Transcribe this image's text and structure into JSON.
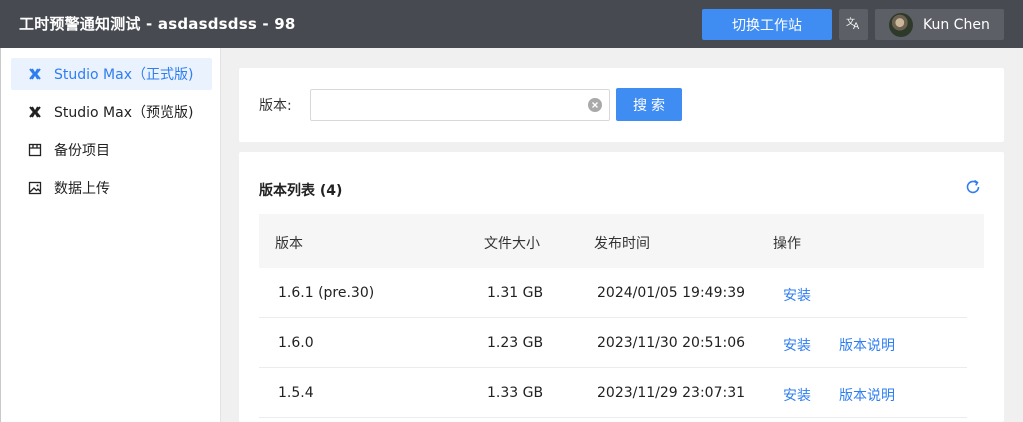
{
  "header": {
    "title": "工时预警通知测试 - asdasdsdss - 98",
    "switch_label": "切换工作站",
    "lang_icon": "translate-icon",
    "user_name": "Kun Chen"
  },
  "sidebar": {
    "items": [
      {
        "label": "Studio Max（正式版)",
        "icon": "studio-max-icon",
        "active": true
      },
      {
        "label": "Studio Max（预览版)",
        "icon": "studio-max-icon",
        "active": false
      },
      {
        "label": "备份项目",
        "icon": "folder-icon",
        "active": false
      },
      {
        "label": "数据上传",
        "icon": "image-icon",
        "active": false
      }
    ]
  },
  "search": {
    "label": "版本:",
    "value": "",
    "placeholder": "",
    "button_label": "搜索"
  },
  "list": {
    "title": "版本列表 (4)",
    "columns": [
      "版本",
      "文件大小",
      "发布时间",
      "操作"
    ],
    "rows": [
      {
        "version": "1.6.1 (pre.30)",
        "size": "1.31 GB",
        "time": "2024/01/05 19:49:39",
        "install": "安装",
        "notes": ""
      },
      {
        "version": "1.6.0",
        "size": "1.23 GB",
        "time": "2023/11/30 20:51:06",
        "install": "安装",
        "notes": "版本说明"
      },
      {
        "version": "1.5.4",
        "size": "1.33 GB",
        "time": "2023/11/29 23:07:31",
        "install": "安装",
        "notes": "版本说明"
      }
    ]
  },
  "colors": {
    "header_bg": "#474a50",
    "accent": "#3f8cf3",
    "link": "#2f7ef0",
    "active_bg": "#eaf2fe"
  }
}
